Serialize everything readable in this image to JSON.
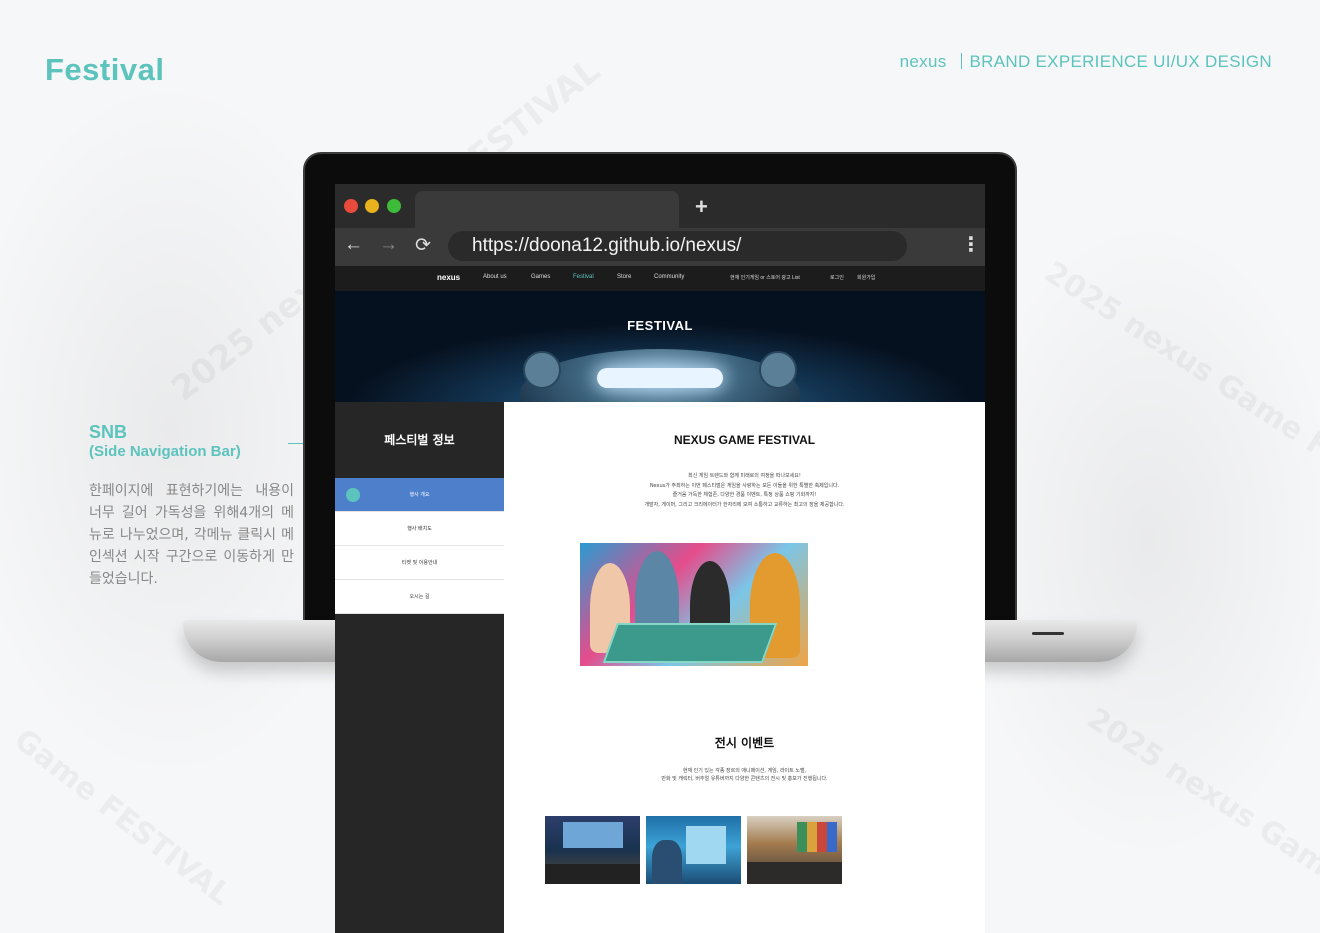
{
  "header": {
    "page_title": "Festival",
    "brand": "nexus",
    "subtitle": "BRAND EXPERIENCE UI/UX DESIGN"
  },
  "annotation": {
    "title": "SNB",
    "subtitle": "(Side Navigation Bar)",
    "description": "한페이지에 표현하기에는 내용이 너무 길어 가독성을 위해4개의 메뉴로 나누었으며, 각메뉴 클릭시 메인섹션 시작 구간으로 이동하게 만들었습니다."
  },
  "browser": {
    "url": "https://doona12.github.io/nexus/",
    "new_tab_icon": "plus-icon",
    "back_icon": "arrow-left-icon",
    "forward_icon": "arrow-right-icon",
    "reload_icon": "reload-icon",
    "menu_icon": "kebab-menu-icon",
    "window_controls": [
      "#e84a3c",
      "#e8b21c",
      "#3fbb3a"
    ]
  },
  "site_nav": {
    "logo": "nexus",
    "items": [
      "About us",
      "Games",
      "Festival",
      "Store",
      "Community"
    ],
    "active": "Festival",
    "promo": "현재 인기게임 or 스토어 광고 List",
    "login": "로그인",
    "signup": "회원가입"
  },
  "hero": {
    "title": "FESTIVAL"
  },
  "snb": {
    "heading": "페스티벌 정보",
    "items": [
      "행사 개요",
      "행사 배치도",
      "티켓 및 이용안내",
      "오시는 길"
    ],
    "active_index": 0
  },
  "main": {
    "title": "NEXUS GAME FESTIVAL",
    "intro": [
      "최신 게임 트렌드와 함께 미래로의 여정을 떠나보세요!",
      "Nexus가 주최하는 이번 페스티벌은 게임을 사랑하는 모든 이들을 위한 특별한 축제입니다.",
      "즐거움 가득한 체험존, 다양한 경품 이벤트, 특정 상품 쇼핑 기회까지!",
      "개발자, 게이머, 그리고 크리에이터가 한자리에 모여 소통하고 교류하는 최고의 장을 제공합니다."
    ],
    "exhibit_title": "전시 이벤트",
    "exhibit_desc": [
      "현재 인기 있는 각종 장르의 애니메이션, 게임, 라이트 노벨,",
      "만화 및 캐릭터, 버추얼 유튜버까지 다양한 콘텐츠의 전시 및 홍보가 진행됩니다."
    ]
  },
  "colors": {
    "accent": "#5cc3bd",
    "snb_active": "#4e7fcb",
    "snb_bg": "#262626"
  }
}
